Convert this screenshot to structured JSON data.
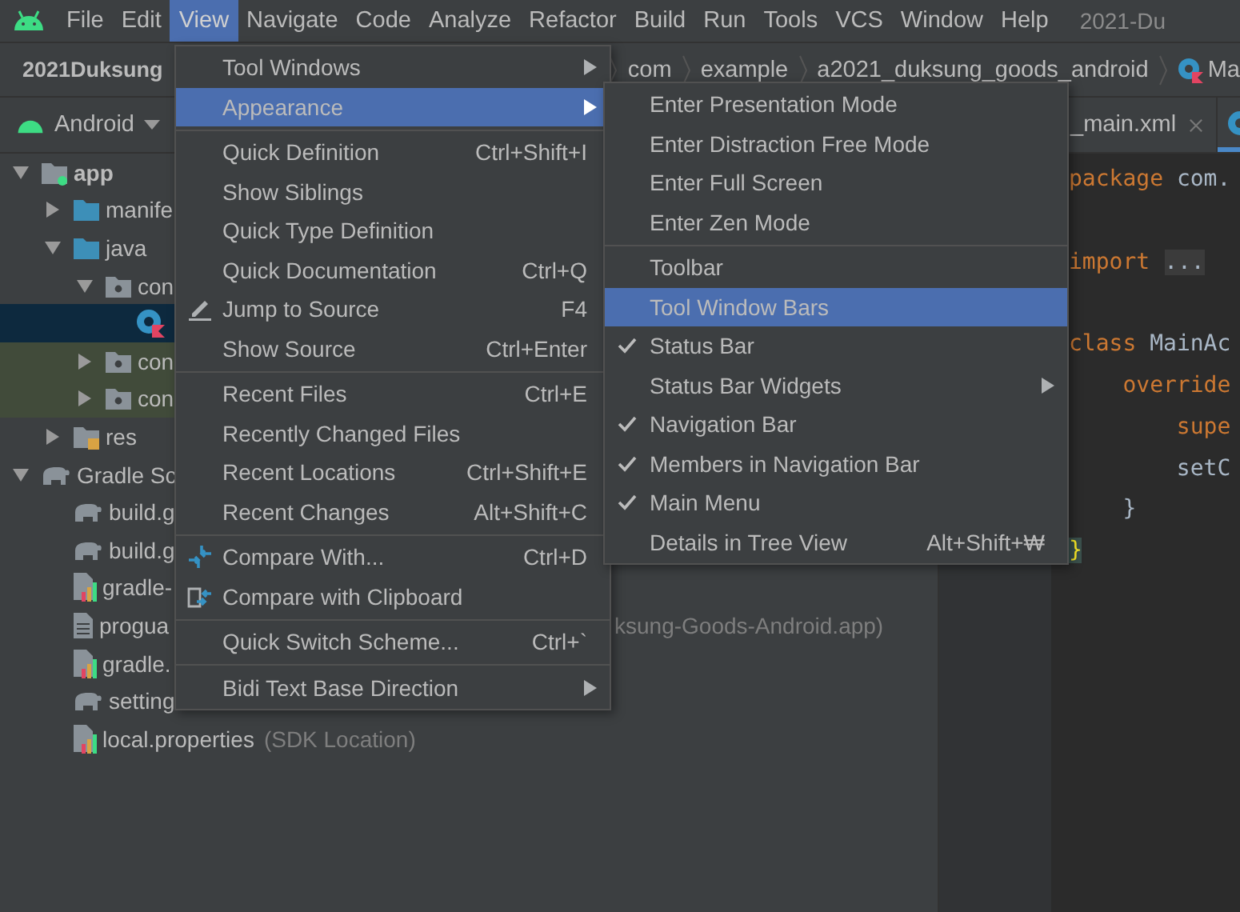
{
  "menubar": {
    "items": [
      {
        "label": "File",
        "selected": false
      },
      {
        "label": "Edit",
        "selected": false
      },
      {
        "label": "View",
        "selected": true
      },
      {
        "label": "Navigate",
        "selected": false
      },
      {
        "label": "Code",
        "selected": false
      },
      {
        "label": "Analyze",
        "selected": false
      },
      {
        "label": "Refactor",
        "selected": false
      },
      {
        "label": "Build",
        "selected": false
      },
      {
        "label": "Run",
        "selected": false
      },
      {
        "label": "Tools",
        "selected": false
      },
      {
        "label": "VCS",
        "selected": false
      },
      {
        "label": "Window",
        "selected": false
      },
      {
        "label": "Help",
        "selected": false
      }
    ],
    "title": "2021-Du"
  },
  "navbar": {
    "project": "2021Duksung",
    "crumbs": [
      {
        "label": "com",
        "kind": "package"
      },
      {
        "label": "example",
        "kind": "package"
      },
      {
        "label": "a2021_duksung_goods_android",
        "kind": "package"
      },
      {
        "label": "Ma",
        "kind": "kotlin"
      }
    ]
  },
  "project_panel": {
    "view": "Android",
    "tree": [
      {
        "label": "app",
        "kind": "module",
        "expanded": true,
        "selected": false,
        "tinted": false,
        "children": [
          {
            "label": "manife",
            "kind": "folder",
            "expanded": false,
            "selected": false,
            "tinted": false
          },
          {
            "label": "java",
            "kind": "folder",
            "expanded": true,
            "selected": false,
            "tinted": false,
            "children": [
              {
                "label": "con",
                "kind": "package",
                "expanded": true,
                "selected": false,
                "tinted": false,
                "children": [
                  {
                    "kind": "kotlin",
                    "selected": true,
                    "tinted": false
                  }
                ]
              },
              {
                "label": "con",
                "kind": "package",
                "expanded": false,
                "selected": false,
                "tinted": true
              },
              {
                "label": "con",
                "kind": "package",
                "expanded": false,
                "selected": false,
                "tinted": true
              }
            ]
          },
          {
            "label": "res",
            "kind": "res",
            "expanded": false,
            "selected": false,
            "tinted": false
          }
        ]
      },
      {
        "label": "Gradle Sc",
        "kind": "gradle",
        "expanded": true,
        "selected": false,
        "tinted": false,
        "children": [
          {
            "label": "build.g",
            "kind": "gradle",
            "selected": false,
            "tinted": false
          },
          {
            "label": "build.g",
            "kind": "gradle",
            "selected": false,
            "tinted": false
          },
          {
            "label": "gradle-",
            "kind": "properties",
            "selected": false,
            "tinted": false
          },
          {
            "label": "progua",
            "kind": "file",
            "selected": false,
            "tinted": false,
            "note": "ksung-Goods-Android.app)",
            "note_after_menu": true
          },
          {
            "label": "gradle.",
            "kind": "properties",
            "selected": false,
            "tinted": false
          },
          {
            "label": "setting",
            "kind": "gradle",
            "selected": false,
            "tinted": false
          },
          {
            "label": "local.properties",
            "kind": "properties",
            "selected": false,
            "tinted": false,
            "note": "(SDK Location)",
            "note_after_menu": false
          }
        ]
      }
    ]
  },
  "editor": {
    "tabs": [
      {
        "label": "_main.xml",
        "kind": "xml",
        "selected": false,
        "closable": true
      },
      {
        "kind": "kotlin",
        "selected": true,
        "closable": false
      }
    ],
    "lines": [
      {
        "kind": "code",
        "tokens": [
          {
            "kind": "keyword",
            "text": "package"
          },
          {
            "kind": "plain",
            "text": " com."
          }
        ]
      },
      {
        "kind": "blank"
      },
      {
        "kind": "code",
        "tokens": [
          {
            "kind": "keyword",
            "text": "import"
          },
          {
            "kind": "fold",
            "text": "..."
          }
        ]
      },
      {
        "kind": "blank"
      },
      {
        "kind": "code",
        "tokens": [
          {
            "kind": "keyword",
            "text": "class"
          },
          {
            "kind": "plain",
            "text": " MainAc"
          }
        ]
      },
      {
        "kind": "code",
        "tokens": [
          {
            "kind": "keyword",
            "text": "    override"
          }
        ]
      },
      {
        "kind": "code",
        "tokens": [
          {
            "kind": "keyword",
            "text": "        supe"
          }
        ]
      },
      {
        "kind": "code",
        "tokens": [
          {
            "kind": "plain",
            "text": "        setC"
          }
        ]
      },
      {
        "kind": "code",
        "tokens": [
          {
            "kind": "plain",
            "text": "    }"
          }
        ]
      },
      {
        "kind": "code",
        "tokens": [
          {
            "kind": "brace-match",
            "text": "}"
          }
        ]
      }
    ]
  },
  "view_menu": [
    {
      "kind": "item",
      "label": "Tool Windows",
      "submenu": true,
      "selected": false
    },
    {
      "kind": "item",
      "label": "Appearance",
      "submenu": true,
      "selected": true
    },
    {
      "kind": "separator"
    },
    {
      "kind": "item",
      "label": "Quick Definition",
      "shortcut": "Ctrl+Shift+I",
      "selected": false
    },
    {
      "kind": "item",
      "label": "Show Siblings",
      "selected": false
    },
    {
      "kind": "item",
      "label": "Quick Type Definition",
      "selected": false
    },
    {
      "kind": "item",
      "label": "Quick Documentation",
      "shortcut": "Ctrl+Q",
      "selected": false
    },
    {
      "kind": "pencil-item",
      "label": "Jump to Source",
      "shortcut": "F4",
      "selected": false
    },
    {
      "kind": "item",
      "label": "Show Source",
      "shortcut": "Ctrl+Enter",
      "selected": false
    },
    {
      "kind": "separator"
    },
    {
      "kind": "item",
      "label": "Recent Files",
      "shortcut": "Ctrl+E",
      "selected": false
    },
    {
      "kind": "item",
      "label": "Recently Changed Files",
      "selected": false
    },
    {
      "kind": "item",
      "label": "Recent Locations",
      "shortcut": "Ctrl+Shift+E",
      "selected": false
    },
    {
      "kind": "item",
      "label": "Recent Changes",
      "shortcut": "Alt+Shift+C",
      "selected": false
    },
    {
      "kind": "separator"
    },
    {
      "kind": "compare-item",
      "label": "Compare With...",
      "shortcut": "Ctrl+D",
      "selected": false
    },
    {
      "kind": "clipboard-item",
      "label": "Compare with Clipboard",
      "selected": false
    },
    {
      "kind": "separator"
    },
    {
      "kind": "item",
      "label": "Quick Switch Scheme...",
      "shortcut": "Ctrl+`",
      "selected": false
    },
    {
      "kind": "separator"
    },
    {
      "kind": "item",
      "label": "Bidi Text Base Direction",
      "submenu": true,
      "selected": false
    }
  ],
  "appearance_menu": [
    {
      "kind": "item",
      "label": "Enter Presentation Mode",
      "checked": false,
      "selected": false
    },
    {
      "kind": "item",
      "label": "Enter Distraction Free Mode",
      "checked": false,
      "selected": false
    },
    {
      "kind": "item",
      "label": "Enter Full Screen",
      "checked": false,
      "selected": false
    },
    {
      "kind": "item",
      "label": "Enter Zen Mode",
      "checked": false,
      "selected": false
    },
    {
      "kind": "separator"
    },
    {
      "kind": "item",
      "label": "Toolbar",
      "checked": false,
      "selected": false
    },
    {
      "kind": "item",
      "label": "Tool Window Bars",
      "checked": false,
      "selected": true
    },
    {
      "kind": "item",
      "label": "Status Bar",
      "checked": true,
      "selected": false
    },
    {
      "kind": "item",
      "label": "Status Bar Widgets",
      "checked": false,
      "selected": false,
      "submenu": true
    },
    {
      "kind": "item",
      "label": "Navigation Bar",
      "checked": true,
      "selected": false
    },
    {
      "kind": "item",
      "label": "Members in Navigation Bar",
      "checked": true,
      "selected": false
    },
    {
      "kind": "item",
      "label": "Main Menu",
      "checked": true,
      "selected": false
    },
    {
      "kind": "item",
      "label": "Details in Tree View",
      "checked": false,
      "selected": false,
      "shortcut": "Alt+Shift+₩"
    }
  ]
}
